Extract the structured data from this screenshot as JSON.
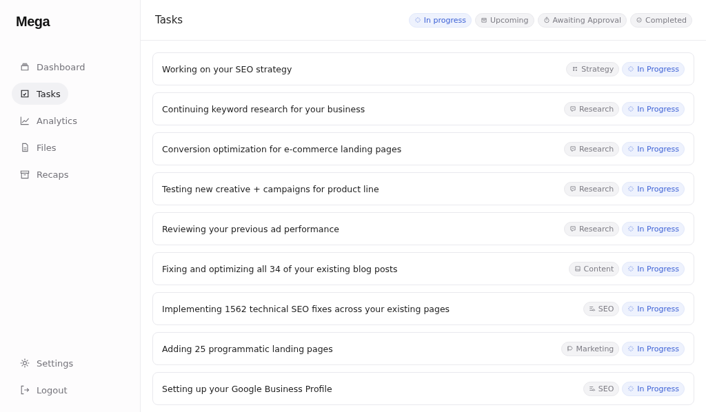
{
  "logo": "Mega",
  "nav": [
    {
      "label": "Dashboard",
      "selected": false
    },
    {
      "label": "Tasks",
      "selected": true
    },
    {
      "label": "Analytics",
      "selected": false
    },
    {
      "label": "Files",
      "selected": false
    },
    {
      "label": "Recaps",
      "selected": false
    }
  ],
  "nav_bottom": [
    {
      "label": "Settings"
    },
    {
      "label": "Logout"
    }
  ],
  "title": "Tasks",
  "filters": [
    {
      "label": "In progress",
      "selected": true
    },
    {
      "label": "Upcoming",
      "selected": false
    },
    {
      "label": "Awaiting Approval",
      "selected": false
    },
    {
      "label": "Completed",
      "selected": false
    }
  ],
  "tasks": [
    {
      "title": "Working on your SEO strategy",
      "category": {
        "kind": "strategy",
        "label": "Strategy"
      },
      "status": "In Progress"
    },
    {
      "title": "Continuing keyword research for your business",
      "category": {
        "kind": "research",
        "label": "Research"
      },
      "status": "In Progress"
    },
    {
      "title": "Conversion optimization for e-commerce landing pages",
      "category": {
        "kind": "research",
        "label": "Research"
      },
      "status": "In Progress"
    },
    {
      "title": "Testing new creative + campaigns for product line",
      "category": {
        "kind": "research",
        "label": "Research"
      },
      "status": "In Progress"
    },
    {
      "title": "Reviewing your previous ad performance",
      "category": {
        "kind": "research",
        "label": "Research"
      },
      "status": "In Progress"
    },
    {
      "title": "Fixing and optimizing all 34 of your existing blog posts",
      "category": {
        "kind": "content",
        "label": "Content"
      },
      "status": "In Progress"
    },
    {
      "title": "Implementing 1562 technical SEO fixes across your existing pages",
      "category": {
        "kind": "seo",
        "label": "SEO"
      },
      "status": "In Progress"
    },
    {
      "title": "Adding 25 programmatic landing pages",
      "category": {
        "kind": "marketing",
        "label": "Marketing"
      },
      "status": "In Progress"
    },
    {
      "title": "Setting up your Google Business Profile",
      "category": {
        "kind": "seo",
        "label": "SEO"
      },
      "status": "In Progress"
    }
  ]
}
